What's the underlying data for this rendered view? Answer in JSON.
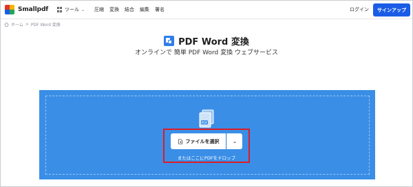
{
  "header": {
    "logo_text": "Smallpdf",
    "tools_label": "ツール",
    "nav": [
      "圧縮",
      "変換",
      "結合",
      "編集",
      "署名"
    ],
    "login_label": "ログイン",
    "signup_label": "サインアップ"
  },
  "breadcrumb": {
    "home": "ホーム",
    "separator": ">",
    "current": "PDF Word 変換"
  },
  "main": {
    "title": "PDF Word 変換",
    "subtitle": "オンラインで 簡単 PDF Word 変換 ウェブサービス",
    "select_file_label": "ファイルを選択",
    "drop_hint": "またはここにPDFをドロップ",
    "file_badge": "PDF"
  },
  "colors": {
    "dropzone": "#3a8ee6",
    "primary_button": "#1a5ce6",
    "highlight_border": "#e01b24",
    "word_icon": "#2f7de9"
  },
  "icons": [
    "smallpdf-logo-icon",
    "grid-icon",
    "chevron-down-icon",
    "home-icon",
    "word-convert-icon",
    "files-icon",
    "file-select-icon"
  ]
}
